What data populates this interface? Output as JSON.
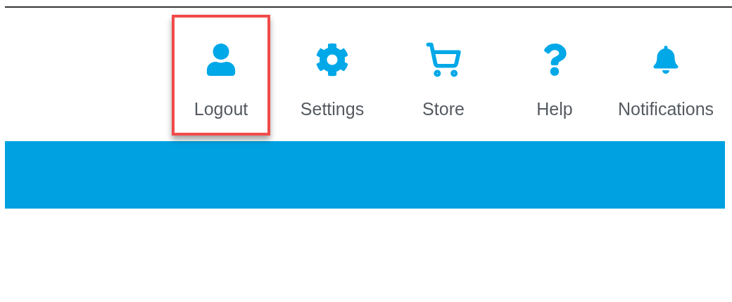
{
  "nav_items": [
    {
      "kind": "user",
      "label": "Logout",
      "highlighted": true
    },
    {
      "kind": "settings",
      "label": "Settings",
      "highlighted": false
    },
    {
      "kind": "cart",
      "label": "Store",
      "highlighted": false
    },
    {
      "kind": "help",
      "label": "Help",
      "highlighted": false
    },
    {
      "kind": "bell",
      "label": "Notifications",
      "highlighted": false
    }
  ]
}
